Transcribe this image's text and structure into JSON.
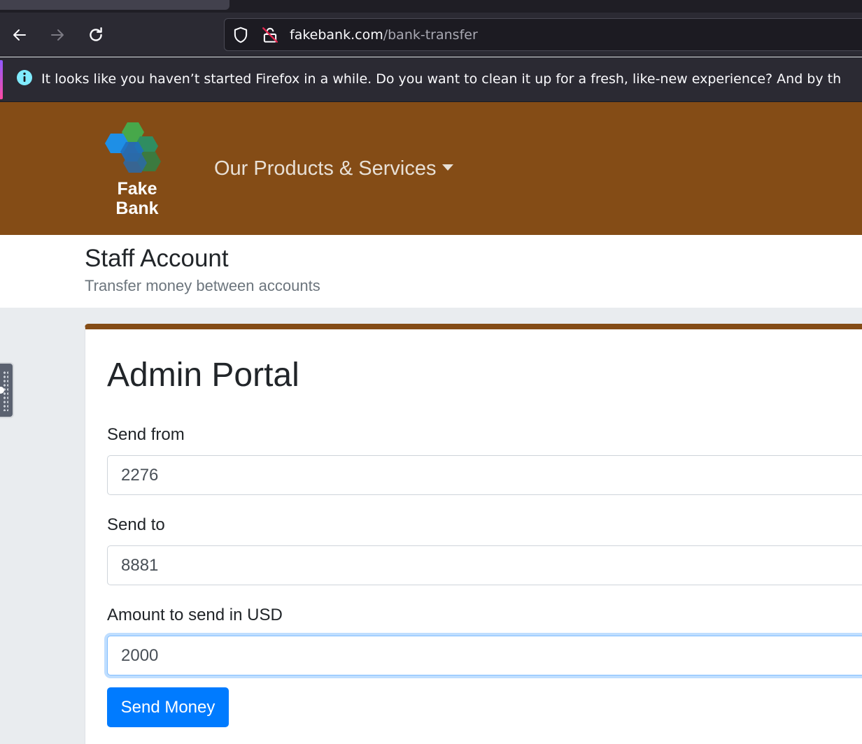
{
  "browser": {
    "url_domain": "fakebank.com",
    "url_path": "/bank-transfer",
    "notification": "It looks like you haven’t started Firefox in a while. Do you want to clean it up for a fresh, like-new experience? And by th"
  },
  "header": {
    "logo_line1": "Fake",
    "logo_line2": "Bank",
    "nav_dropdown_label": "Our Products & Services"
  },
  "subheader": {
    "title": "Staff Account",
    "subtitle": "Transfer money between accounts"
  },
  "portal": {
    "title": "Admin Portal",
    "send_from_label": "Send from",
    "send_from_value": "2276",
    "send_to_label": "Send to",
    "send_to_value": "8881",
    "amount_label": "Amount to send in USD",
    "amount_value": "2000",
    "submit_label": "Send Money"
  },
  "colors": {
    "brand_brown": "#844c16",
    "primary_blue": "#007bff",
    "page_bg": "#e9ecef"
  }
}
